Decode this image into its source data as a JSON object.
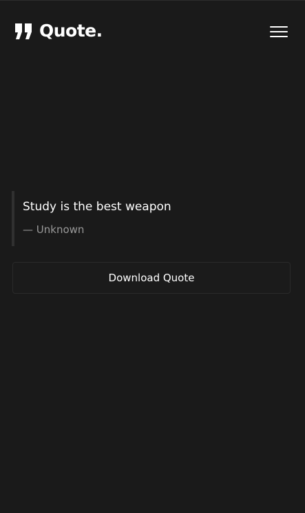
{
  "header": {
    "logo_text": "Quote.",
    "logo_icon": "quote-marks-icon",
    "menu_icon": "hamburger-menu-icon"
  },
  "quote": {
    "text": "Study is the best weapon",
    "author": "— Unknown"
  },
  "actions": {
    "download_label": "Download Quote"
  },
  "colors": {
    "background": "#1a1a1a",
    "text": "#ffffff",
    "muted_text": "#9a9a9a",
    "quote_border": "#303030",
    "button_border": "#2a2a2a"
  }
}
